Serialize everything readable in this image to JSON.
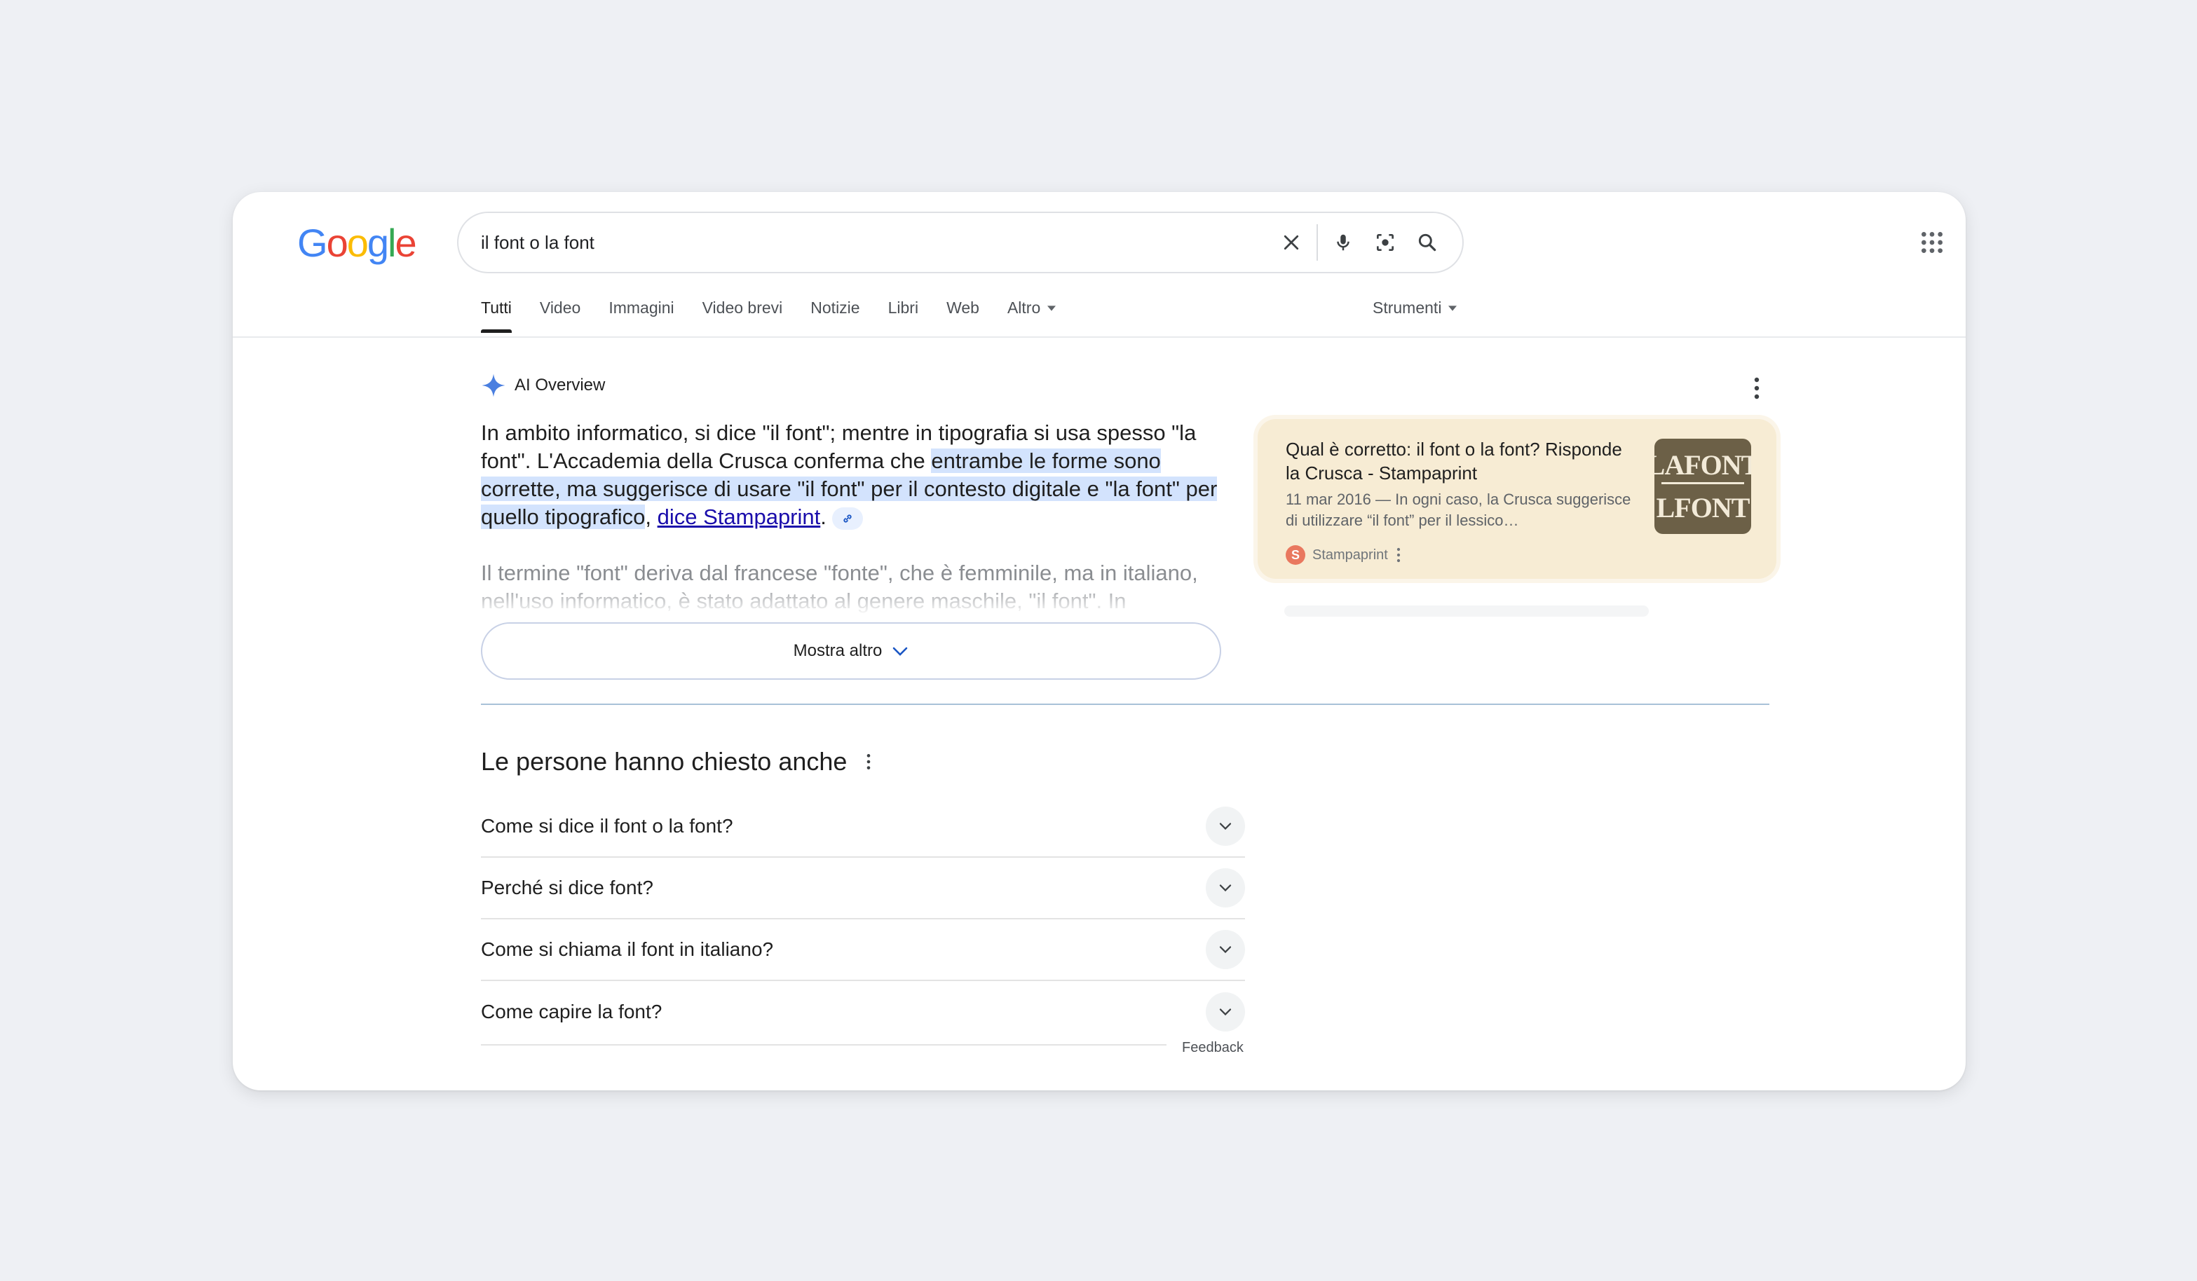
{
  "logo": {
    "letters": [
      "G",
      "o",
      "o",
      "g",
      "l",
      "e"
    ],
    "colors": [
      "#4285F4",
      "#EA4335",
      "#FBBC05",
      "#4285F4",
      "#34A853",
      "#EA4335"
    ]
  },
  "search": {
    "query": "il font o la font"
  },
  "icons": {
    "clear": "close-icon",
    "mic": "microphone-icon",
    "lens": "camera-search-icon",
    "search": "search-icon",
    "apps": "apps-grid-icon"
  },
  "tabs": [
    {
      "label": "Tutti",
      "active": true
    },
    {
      "label": "Video"
    },
    {
      "label": "Immagini"
    },
    {
      "label": "Video brevi"
    },
    {
      "label": "Notizie"
    },
    {
      "label": "Libri"
    },
    {
      "label": "Web"
    },
    {
      "label": "Altro",
      "dropdown": true
    }
  ],
  "tools_label": "Strumenti",
  "ai_overview": {
    "heading": "AI Overview",
    "para_plain": "In ambito informatico, si dice \"il font\"; mentre in tipografia si usa spesso \"la font\". L'Accademia della Crusca conferma che ",
    "para_highlight": "entrambe le forme sono corrette, ma suggerisce di usare \"il font\" per il contesto digitale e \"la font\" per quello tipografico",
    "para_sep": ", ",
    "para_link": "dice Stampaprint",
    "para_end": ".",
    "para2": "Il termine \"font\" deriva dal francese \"fonte\", che è femminile, ma in italiano, nell'uso informatico, è stato adattato al genere maschile, \"il font\". In tipografia,",
    "show_more": "Mostra altro"
  },
  "source_card": {
    "title": "Qual è corretto: il font o la font? Risponde la Crusca - Stampaprint",
    "snippet": "11 mar 2016 — In ogni caso, la Crusca suggerisce di utilizzare “il font” per il lessico…",
    "site": "Stampaprint",
    "favicon_letter": "S",
    "thumb_line1": "LAFONT",
    "thumb_line2": "LFONT"
  },
  "paa": {
    "title": "Le persone hanno chiesto anche",
    "questions": [
      "Come si dice il font o la font?",
      "Perché si dice font?",
      "Come si chiama il font in italiano?",
      "Come capire la font?"
    ],
    "feedback": "Feedback"
  }
}
